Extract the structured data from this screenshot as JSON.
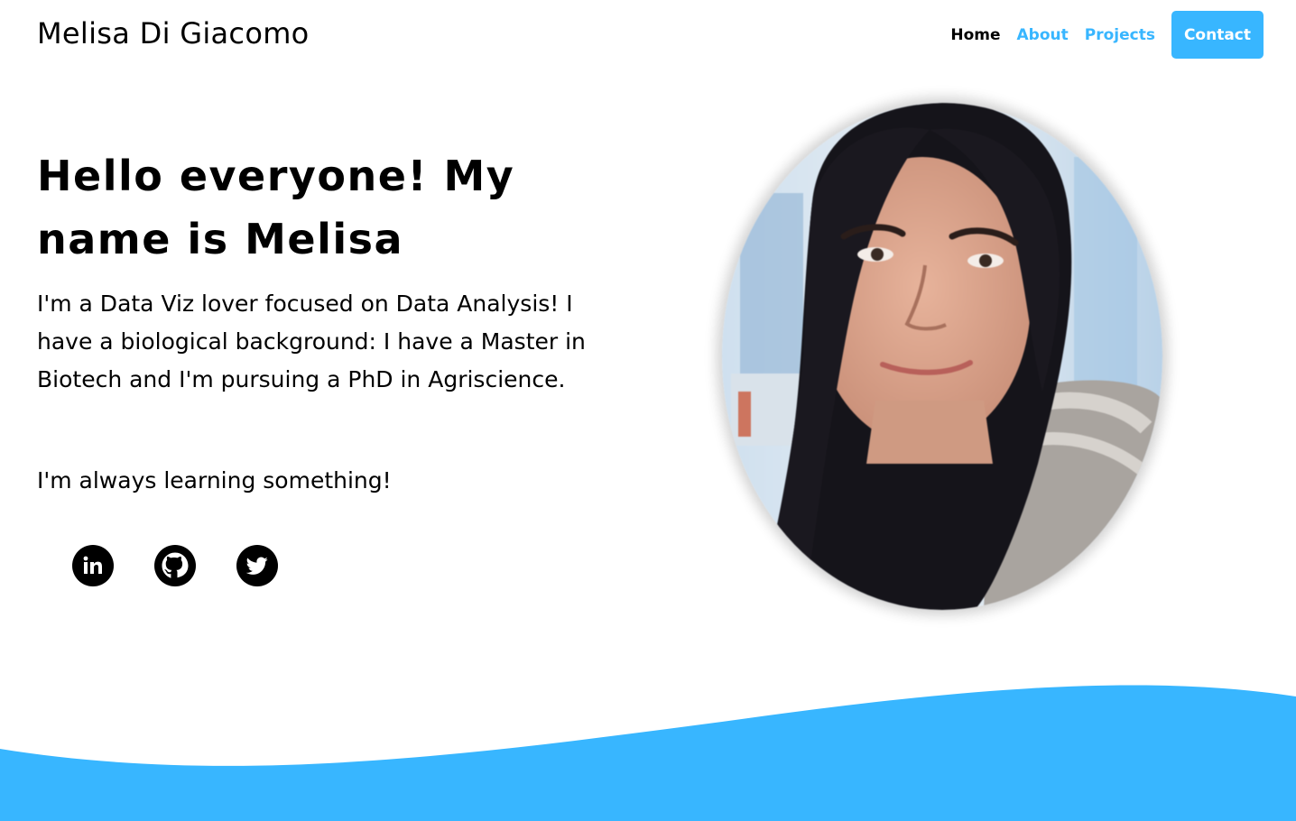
{
  "header": {
    "brand": "Melisa Di Giacomo",
    "nav": {
      "home": "Home",
      "about": "About",
      "projects": "Projects",
      "contact": "Contact"
    }
  },
  "hero": {
    "heading": "Hello everyone! My name is Melisa",
    "intro": "I'm a Data Viz lover focused on Data Analysis! I have a biological background: I have a Master in Biotech and I'm pursuing a PhD in Agriscience.",
    "tagline": "I'm always learning something!",
    "social": [
      "linkedin-icon",
      "github-icon",
      "twitter-icon"
    ]
  },
  "colors": {
    "accent": "#38b6ff",
    "text": "#000000",
    "background": "#ffffff"
  }
}
